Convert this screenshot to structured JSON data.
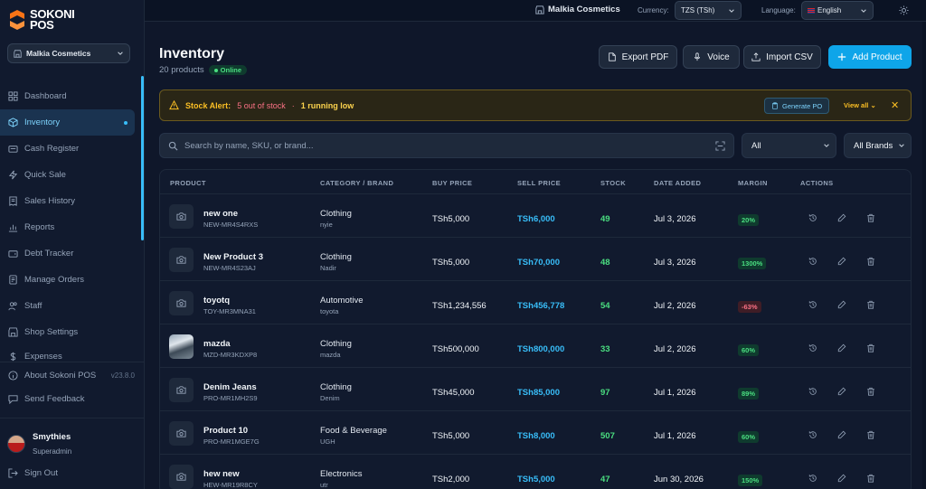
{
  "brand": {
    "line1": "SOKONI",
    "line2": "POS"
  },
  "store_select": {
    "name": "Malkia Cosmetics"
  },
  "nav": {
    "items": [
      {
        "label": "Dashboard",
        "icon": "dashboard-icon"
      },
      {
        "label": "Inventory",
        "icon": "box-icon",
        "active": true
      },
      {
        "label": "Cash Register",
        "icon": "register-icon"
      },
      {
        "label": "Quick Sale",
        "icon": "bolt-icon"
      },
      {
        "label": "Sales History",
        "icon": "receipt-icon"
      },
      {
        "label": "Reports",
        "icon": "chart-icon"
      },
      {
        "label": "Debt Tracker",
        "icon": "wallet-icon"
      },
      {
        "label": "Manage Orders",
        "icon": "orders-icon"
      },
      {
        "label": "Staff",
        "icon": "users-icon"
      },
      {
        "label": "Shop Settings",
        "icon": "shop-icon"
      },
      {
        "label": "Expenses",
        "icon": "dollar-icon"
      }
    ]
  },
  "about": {
    "label": "About Sokoni POS",
    "version": "v23.8.0"
  },
  "feedback": {
    "label": "Send Feedback"
  },
  "user": {
    "name": "Smythies",
    "role": "Superadmin"
  },
  "signout": {
    "label": "Sign Out"
  },
  "topbar": {
    "store": "Malkia Cosmetics",
    "currency_label": "Currency:",
    "currency_value": "TZS (TSh)",
    "language_label": "Language:",
    "language_value": "English"
  },
  "page": {
    "title": "Inventory",
    "count": "20 products",
    "status": "Online"
  },
  "actions": {
    "export_pdf": "Export PDF",
    "voice": "Voice",
    "import_csv": "Import CSV",
    "add_product": "Add Product"
  },
  "alert": {
    "title": "Stock Alert:",
    "out": "5 out of stock",
    "sep": "·",
    "low": "1 running low",
    "generate_po": "Generate PO",
    "view_all": "View all"
  },
  "search": {
    "placeholder": "Search by name, SKU, or brand..."
  },
  "filters": {
    "category": "All",
    "brand": "All Brands"
  },
  "table": {
    "headers": [
      "PRODUCT",
      "CATEGORY / BRAND",
      "BUY PRICE",
      "SELL PRICE",
      "STOCK",
      "DATE ADDED",
      "MARGIN",
      "ACTIONS"
    ],
    "rows": [
      {
        "name": "new one",
        "sku": "NEW-MR4S4RXS",
        "category": "Clothing",
        "brand": "nyie",
        "buy": "TSh5,000",
        "sell": "TSh6,000",
        "stock": "49",
        "date": "Jul 3, 2026",
        "margin": "20%",
        "negative": false,
        "photo": false
      },
      {
        "name": "New Product 3",
        "sku": "NEW-MR4S23AJ",
        "category": "Clothing",
        "brand": "Nadir",
        "buy": "TSh5,000",
        "sell": "TSh70,000",
        "stock": "48",
        "date": "Jul 3, 2026",
        "margin": "1300%",
        "negative": false,
        "photo": false
      },
      {
        "name": "toyotq",
        "sku": "TOY-MR3MNA31",
        "category": "Automotive",
        "brand": "toyota",
        "buy": "TSh1,234,556",
        "sell": "TSh456,778",
        "stock": "54",
        "date": "Jul 2, 2026",
        "margin": "-63%",
        "negative": true,
        "photo": false
      },
      {
        "name": "mazda",
        "sku": "MZD-MR3KDXP8",
        "category": "Clothing",
        "brand": "mazda",
        "buy": "TSh500,000",
        "sell": "TSh800,000",
        "stock": "33",
        "date": "Jul 2, 2026",
        "margin": "60%",
        "negative": false,
        "photo": true
      },
      {
        "name": "Denim Jeans",
        "sku": "PRO-MR1MH2S9",
        "category": "Clothing",
        "brand": "Denim",
        "buy": "TSh45,000",
        "sell": "TSh85,000",
        "stock": "97",
        "date": "Jul 1, 2026",
        "margin": "89%",
        "negative": false,
        "photo": false
      },
      {
        "name": "Product 10",
        "sku": "PRO-MR1MGE7G",
        "category": "Food & Beverage",
        "brand": "UGH",
        "buy": "TSh5,000",
        "sell": "TSh8,000",
        "stock": "507",
        "date": "Jul 1, 2026",
        "margin": "60%",
        "negative": false,
        "photo": false
      },
      {
        "name": "hew new",
        "sku": "HEW-MR19R8CY",
        "category": "Electronics",
        "brand": "utr",
        "buy": "TSh2,000",
        "sell": "TSh5,000",
        "stock": "47",
        "date": "Jun 30, 2026",
        "margin": "150%",
        "negative": false,
        "photo": false
      }
    ]
  },
  "colors": {
    "accent": "#0ea5e9",
    "background": "#0f172a",
    "success": "#4ade80",
    "danger": "#fb7185",
    "warning": "#fbbf24"
  }
}
